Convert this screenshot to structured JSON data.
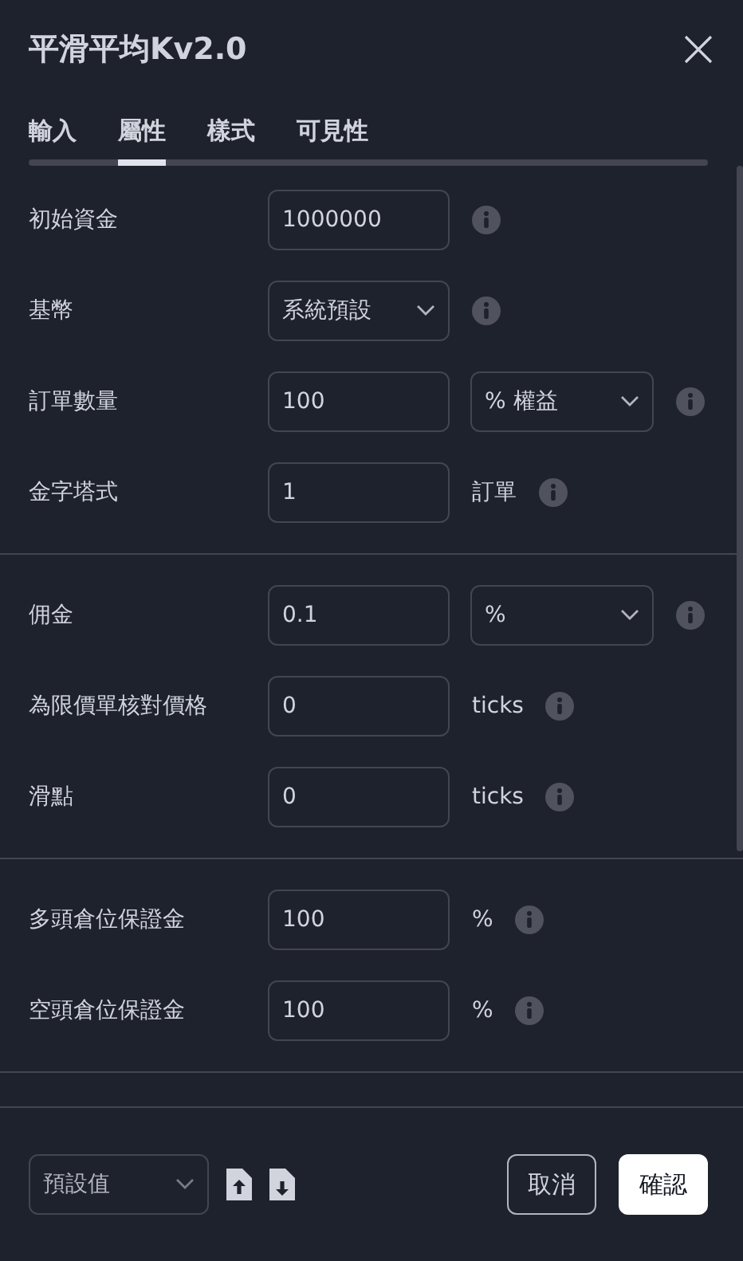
{
  "title": "平滑平均Kv2.0",
  "tabs": [
    {
      "label": "輸入",
      "selected": false
    },
    {
      "label": "屬性",
      "selected": true
    },
    {
      "label": "樣式",
      "selected": false
    },
    {
      "label": "可見性",
      "selected": false
    }
  ],
  "sections": [
    [
      {
        "label": "初始資金",
        "field": {
          "kind": "input",
          "value": "1000000"
        }
      },
      {
        "label": "基幣",
        "field": {
          "kind": "select",
          "value": "系統預設"
        }
      },
      {
        "label": "訂單數量",
        "field": {
          "kind": "input",
          "value": "100"
        },
        "extra": {
          "kind": "select",
          "value": "% 權益"
        }
      },
      {
        "label": "金字塔式",
        "field": {
          "kind": "input",
          "value": "1"
        },
        "extra": {
          "kind": "text",
          "value": "訂單"
        }
      }
    ],
    [
      {
        "label": "佣金",
        "field": {
          "kind": "input",
          "value": "0.1"
        },
        "extra": {
          "kind": "select",
          "value": "%"
        }
      },
      {
        "label": "為限價單核對價格",
        "field": {
          "kind": "input",
          "value": "0"
        },
        "extra": {
          "kind": "text",
          "value": "ticks"
        }
      },
      {
        "label": "滑點",
        "field": {
          "kind": "input",
          "value": "0"
        },
        "extra": {
          "kind": "text",
          "value": "ticks"
        }
      }
    ],
    [
      {
        "label": "多頭倉位保證金",
        "field": {
          "kind": "input",
          "value": "100"
        },
        "extra": {
          "kind": "text",
          "value": "%"
        }
      },
      {
        "label": "空頭倉位保證金",
        "field": {
          "kind": "input",
          "value": "100"
        },
        "extra": {
          "kind": "text",
          "value": "%"
        }
      }
    ]
  ],
  "footer": {
    "preset": "預設值",
    "buttons": [
      {
        "label": "取消",
        "kind": "secondary"
      },
      {
        "label": "確認",
        "kind": "primary"
      }
    ]
  }
}
